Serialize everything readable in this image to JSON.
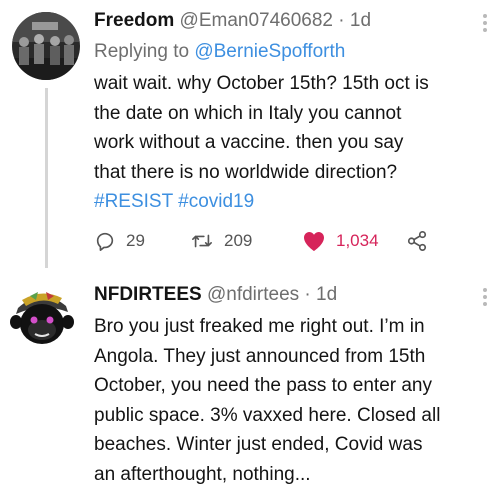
{
  "tweets": [
    {
      "author_name": "Freedom",
      "author_handle": "@Eman07460682",
      "separator": "·",
      "age": "1d",
      "reply_prefix": "Replying to ",
      "reply_mention": "@BernieSpofforth",
      "text": "wait wait. why October 15th? 15th oct is\nthe date on which in Italy you cannot\nwork without a vaccine. then you say\nthat there is no worldwide direction?",
      "hashtags": "#RESIST #covid19",
      "replies": "29",
      "retweets": "209",
      "likes": "1,034",
      "liked": true
    },
    {
      "author_name": "NFDIRTEES",
      "author_handle": "@nfdirtees",
      "separator": "·",
      "age": "1d",
      "text": "Bro you just freaked me right out. I’m in\nAngola. They just announced from 15th\nOctober, you need the pass to enter any\npublic space. 3% vaxxed here. Closed all\nbeaches. Winter just ended, Covid was\nan afterthought, nothing..."
    }
  ],
  "icons": {
    "reply": "reply-icon",
    "retweet": "retweet-icon",
    "like": "heart-icon",
    "share": "share-icon",
    "more": "more-icon"
  },
  "colors": {
    "link": "#3d8fe0",
    "like": "#d6245a",
    "muted": "#6e6e6e",
    "text": "#141414"
  }
}
